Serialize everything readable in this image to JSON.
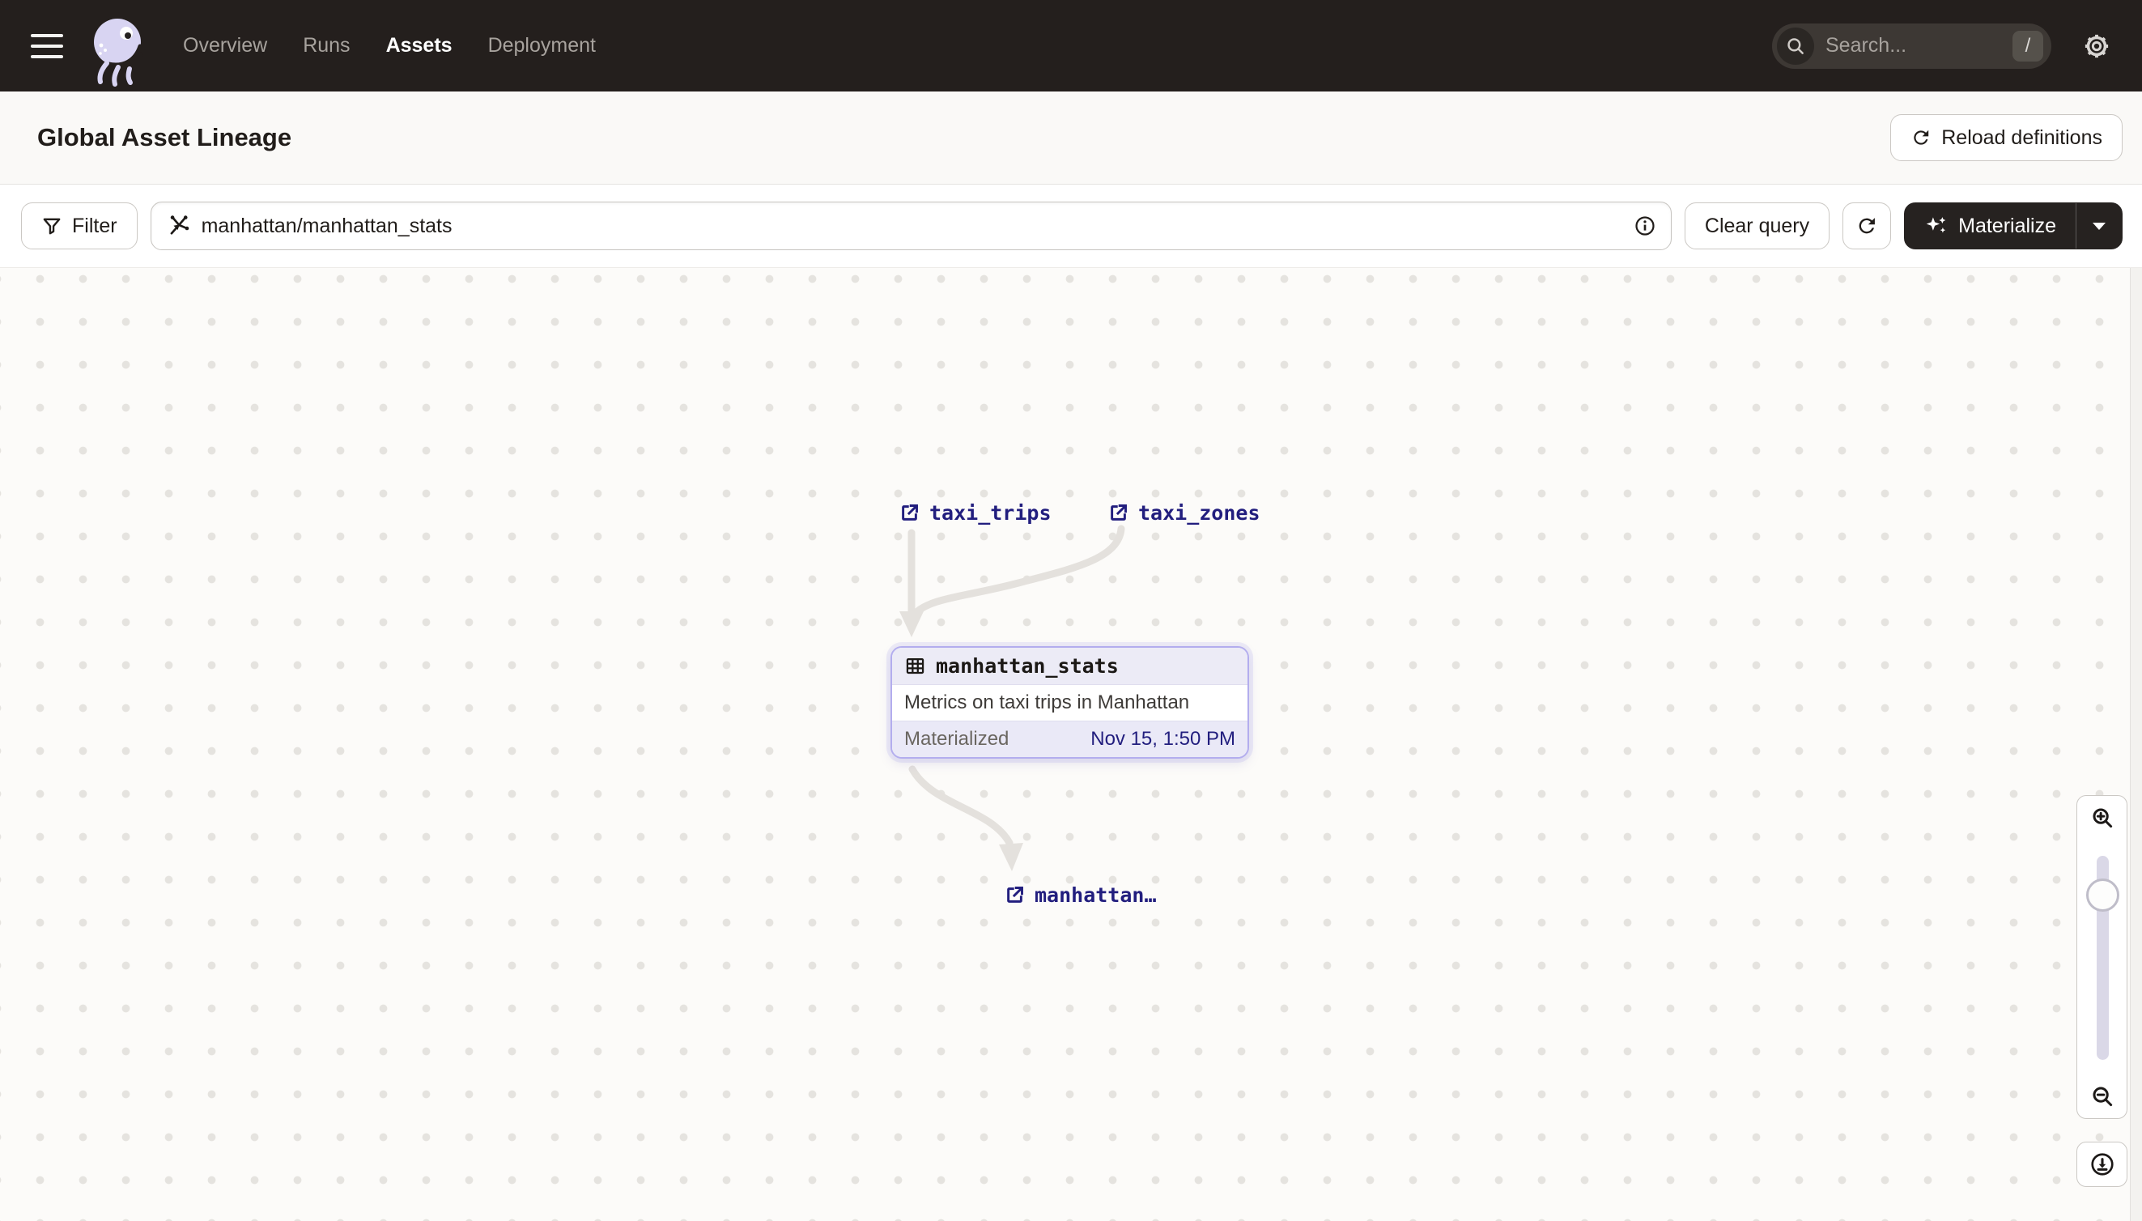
{
  "nav": {
    "items": [
      {
        "label": "Overview",
        "active": false
      },
      {
        "label": "Runs",
        "active": false
      },
      {
        "label": "Assets",
        "active": true
      },
      {
        "label": "Deployment",
        "active": false
      }
    ],
    "search": {
      "placeholder": "Search...",
      "shortcut": "/"
    }
  },
  "header": {
    "title": "Global Asset Lineage",
    "reload_button": "Reload definitions"
  },
  "toolbar": {
    "filter_button": "Filter",
    "query_value": "manhattan/manhattan_stats",
    "clear_button": "Clear query",
    "materialize_button": "Materialize"
  },
  "graph": {
    "upstream_nodes": [
      {
        "label": "taxi_trips"
      },
      {
        "label": "taxi_zones"
      }
    ],
    "asset_card": {
      "name": "manhattan_stats",
      "description": "Metrics on taxi trips in Manhattan",
      "status_label": "Materialized",
      "status_time": "Nov 15, 1:50 PM"
    },
    "downstream_nodes": [
      {
        "label": "manhattan…"
      }
    ]
  },
  "icons": {
    "logo": "dagster-octopus",
    "nav_search": "search-icon",
    "settings": "gear-icon",
    "filter": "funnel-icon",
    "query": "lineage-splat-icon",
    "query_info": "info-icon",
    "refresh": "refresh-icon",
    "materialize": "sparkle-icon",
    "asset_links": "external-link-icon",
    "asset_card": "table-icon",
    "zoom_in": "zoom-in-icon",
    "zoom_out": "zoom-out-icon",
    "download": "download-icon"
  },
  "colors": {
    "nav_bg": "#241F1D",
    "page_bg": "#FAF9F7",
    "accent_link": "#221E7E",
    "card_border": "#B3ADEE",
    "card_header_bg": "#ECEBF6",
    "card_footer_bg": "#EAE9F7",
    "edge": "#E4E1DD",
    "logo_lavender": "#D8D4F2"
  }
}
